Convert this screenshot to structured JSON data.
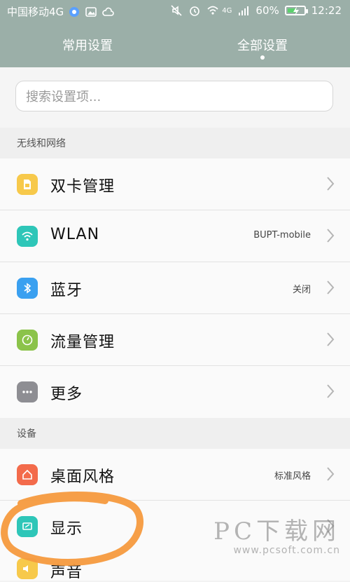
{
  "status_bar": {
    "carrier": "中国移动4G",
    "battery": "60%",
    "time": "12:22",
    "network_badge": "4G",
    "icons": [
      "app-notification-icon",
      "image-icon",
      "cloud-icon",
      "mute-icon",
      "alarm-icon",
      "wifi-icon",
      "signal-icon",
      "battery-icon"
    ],
    "battery_level": 0.6
  },
  "tabs": [
    {
      "label": "常用设置",
      "active": false
    },
    {
      "label": "全部设置",
      "active": true
    }
  ],
  "search": {
    "placeholder": "搜索设置项..."
  },
  "sections": [
    {
      "header": "无线和网络",
      "items": [
        {
          "label": "双卡管理",
          "value": "",
          "icon": "sim-card-icon",
          "color": "#f7c94b"
        },
        {
          "label": "WLAN",
          "value": "BUPT-mobile",
          "icon": "wifi-icon",
          "color": "#2ec6b8"
        },
        {
          "label": "蓝牙",
          "value": "关闭",
          "icon": "bluetooth-icon",
          "color": "#3aa0f0"
        },
        {
          "label": "流量管理",
          "value": "",
          "icon": "data-usage-icon",
          "color": "#8bc34a"
        },
        {
          "label": "更多",
          "value": "",
          "icon": "more-icon",
          "color": "#8e8e93"
        }
      ]
    },
    {
      "header": "设备",
      "items": [
        {
          "label": "桌面风格",
          "value": "标准风格",
          "icon": "home-icon",
          "color": "#f36b4b"
        },
        {
          "label": "显示",
          "value": "",
          "icon": "display-icon",
          "color": "#2ec6b8"
        },
        {
          "label": "声音",
          "value": "",
          "icon": "sound-icon",
          "color": "#f7c94b"
        }
      ]
    }
  ],
  "watermark": {
    "big": "PC下载网",
    "small": "www.pcsoft.com.cn"
  },
  "colors": {
    "header_bg": "#9bafa8",
    "highlight": "#f59a3e"
  }
}
